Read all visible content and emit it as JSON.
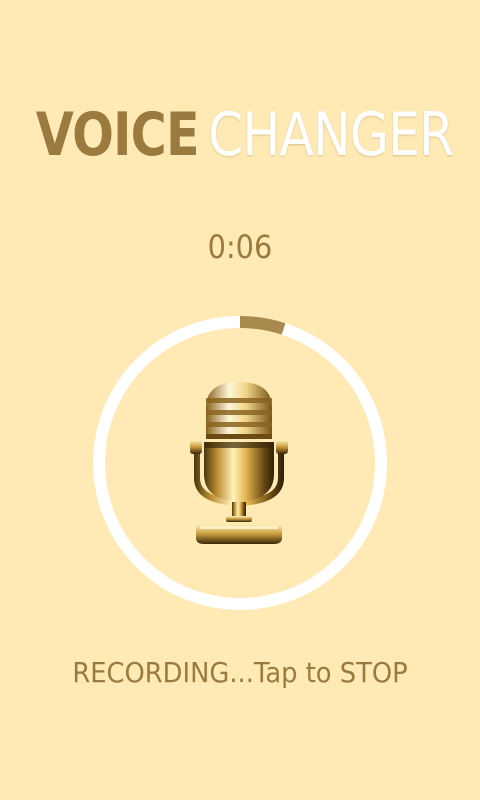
{
  "header": {
    "title_bold": "VOICE",
    "title_light": "CHANGER"
  },
  "recorder": {
    "elapsed": "0:06",
    "progress_fraction": 0.05,
    "status_text": "RECORDING...Tap to STOP"
  },
  "icons": {
    "microphone": "microphone-icon"
  },
  "colors": {
    "background": "#FFEAB5",
    "accent": "#9A7A3E",
    "ring_track": "#FFFFFF",
    "ring_progress": "#A88A4C"
  }
}
